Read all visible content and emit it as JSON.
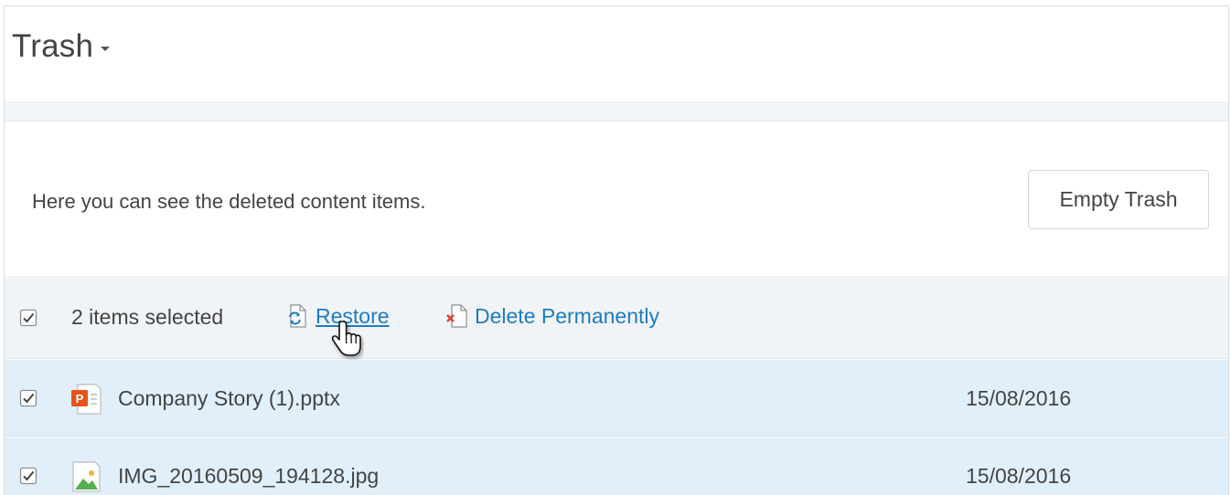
{
  "header": {
    "title": "Trash"
  },
  "info": {
    "message": "Here you can see the deleted content items.",
    "empty_button": "Empty Trash"
  },
  "toolbar": {
    "selected_text": "2 items selected",
    "restore_label": "Restore",
    "delete_label": "Delete Permanently"
  },
  "files": [
    {
      "name": "Company Story (1).pptx",
      "date": "15/08/2016",
      "icon": "powerpoint-file-icon",
      "checked": true
    },
    {
      "name": "IMG_20160509_194128.jpg",
      "date": "15/08/2016",
      "icon": "image-file-icon",
      "checked": true
    }
  ],
  "colors": {
    "link": "#1d7dc2",
    "selected_row": "#e1effb",
    "toolbar_bg": "#f1f4f7"
  }
}
